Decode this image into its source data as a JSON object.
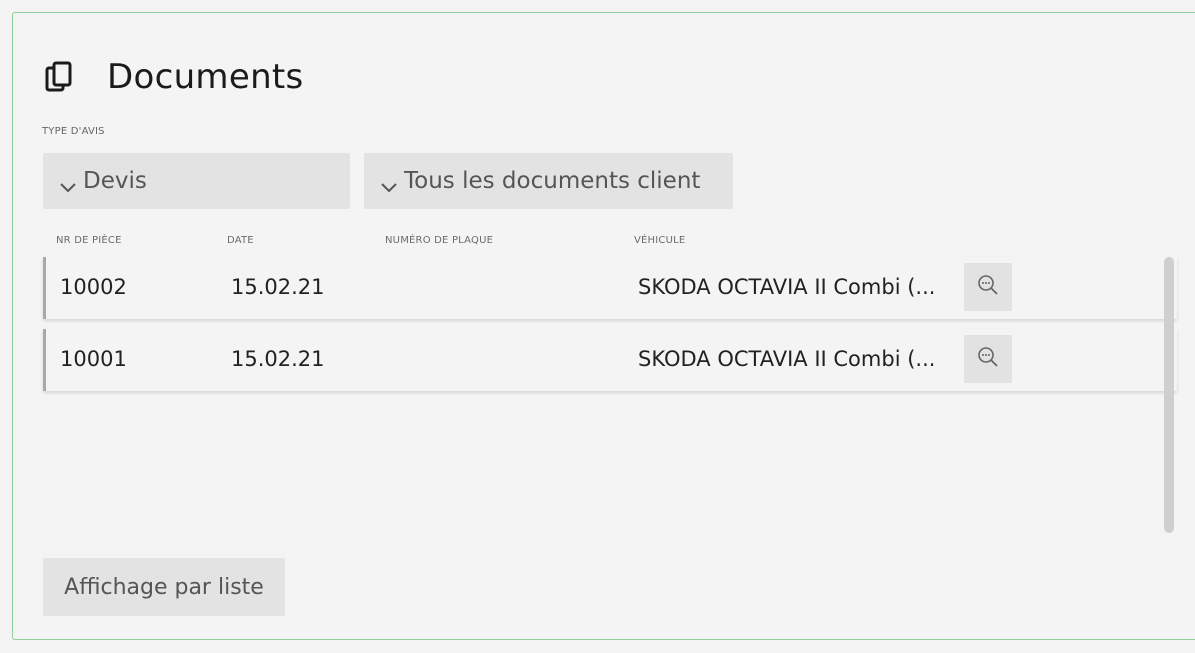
{
  "header": {
    "title": "Documents",
    "icon": "copy-icon"
  },
  "filters": {
    "label": "TYPE D'AVIS",
    "type_value": "Devis",
    "scope_value": "Tous les documents client"
  },
  "table": {
    "columns": [
      "NR DE PIÈCE",
      "DATE",
      "NUMÉRO DE PLAQUE",
      "VÉHICULE"
    ],
    "rows": [
      {
        "nr": "10002",
        "date": "15.02.21",
        "plate": "",
        "vehicle": "SKODA OCTAVIA II Combi (..."
      },
      {
        "nr": "10001",
        "date": "15.02.21",
        "plate": "",
        "vehicle": "SKODA OCTAVIA II Combi (..."
      }
    ]
  },
  "footer": {
    "list_view_label": "Affichage par liste"
  },
  "colors": {
    "border_accent": "#8fd09a",
    "button_bg": "#e3e3e3"
  }
}
